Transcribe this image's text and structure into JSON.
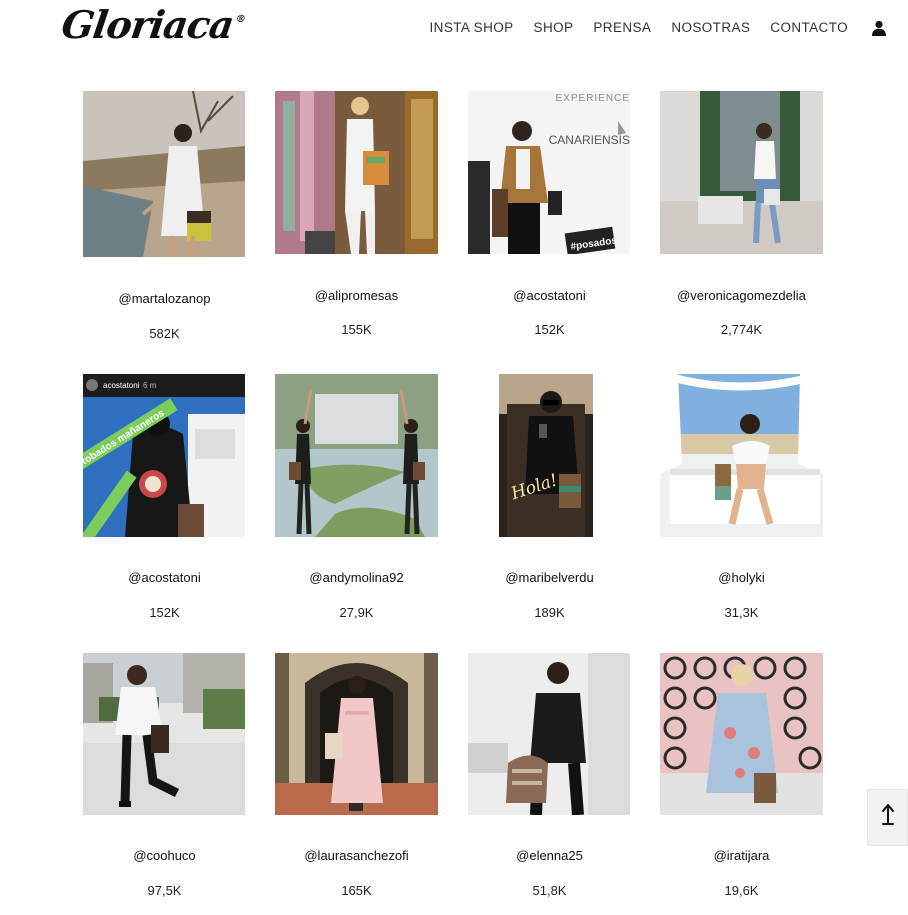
{
  "brand": {
    "logo_text": "Gloriaca",
    "reg_mark": "®"
  },
  "nav": {
    "items": [
      "INSTA SHOP",
      "SHOP",
      "PRENSA",
      "NOSOTRAS",
      "CONTACTO"
    ]
  },
  "icons": {
    "account": "user-icon",
    "back_to_top": "arrow-up-icon"
  },
  "grid": {
    "rows": [
      [
        {
          "handle": "@martalozanop",
          "followers": "582K"
        },
        {
          "handle": "@alipromesas",
          "followers": "155K"
        },
        {
          "handle": "@acostatoni",
          "followers": "152K"
        },
        {
          "handle": "@veronicagomezdelia",
          "followers": "2,774K"
        }
      ],
      [
        {
          "handle": "@acostatoni",
          "followers": "152K"
        },
        {
          "handle": "@andymolina92",
          "followers": "27,9K"
        },
        {
          "handle": "@maribelverdu",
          "followers": "189K"
        },
        {
          "handle": "@holyki",
          "followers": "31,3K"
        }
      ],
      [
        {
          "handle": "@coohuco",
          "followers": "97,5K"
        },
        {
          "handle": "@laurasanchezofi",
          "followers": "165K"
        },
        {
          "handle": "@elenna25",
          "followers": "51,8K"
        },
        {
          "handle": "@iratijara",
          "followers": "19,6K"
        }
      ]
    ]
  },
  "photo_text": {
    "r0c2_banner_top": "EXPERIENCE",
    "r0c2_banner_mid": "CANARIENSIS",
    "r0c2_tag": "#posados",
    "r1c0_user": "acostatoni",
    "r1c0_time": "6 m",
    "r1c0_sticker": "Robados mañaneros",
    "r1c2_neon": "Hola!"
  }
}
